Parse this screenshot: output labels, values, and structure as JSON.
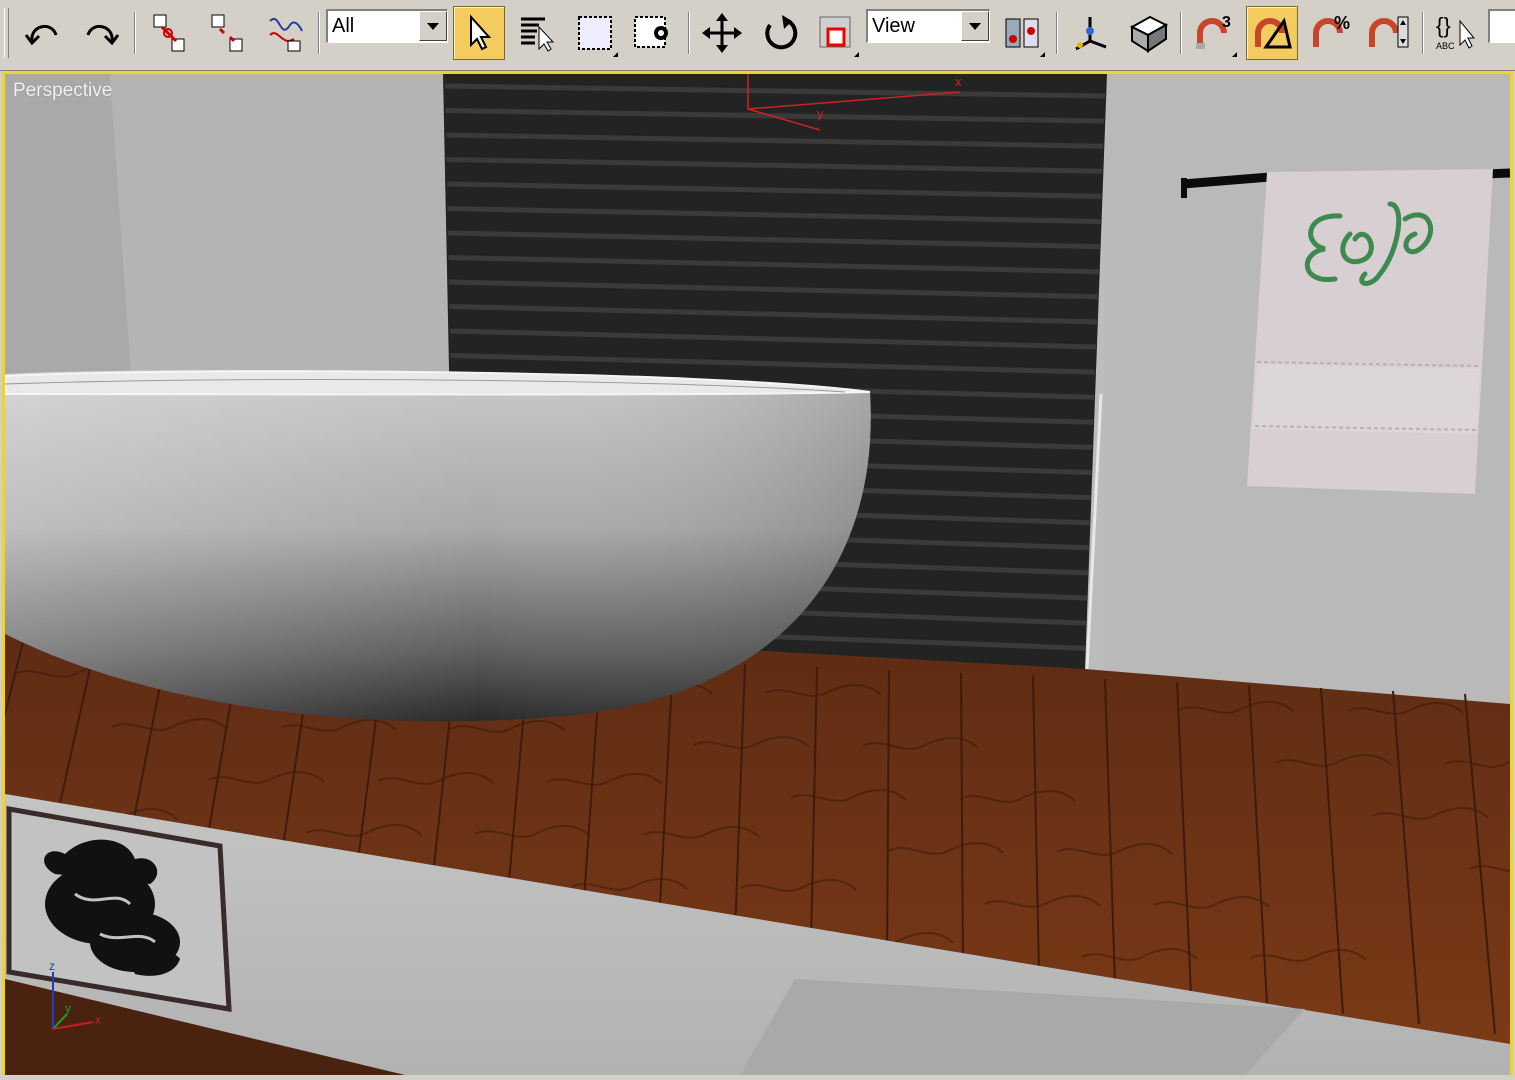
{
  "toolbar": {
    "buttons": [
      {
        "icon": "undo-icon",
        "state": "normal"
      },
      {
        "icon": "redo-icon",
        "state": "normal"
      },
      {
        "icon": "select-and-link-icon",
        "state": "normal"
      },
      {
        "icon": "unlink-selection-icon",
        "state": "normal"
      },
      {
        "icon": "bind-to-space-warp-icon",
        "state": "normal"
      },
      {
        "icon": "select-object-icon",
        "state": "active"
      },
      {
        "icon": "select-by-name-icon",
        "state": "normal"
      },
      {
        "icon": "rectangular-selection-region-icon",
        "state": "normal"
      },
      {
        "icon": "window-crossing-icon",
        "state": "normal"
      },
      {
        "icon": "select-and-move-icon",
        "state": "normal"
      },
      {
        "icon": "select-and-rotate-icon",
        "state": "normal"
      },
      {
        "icon": "select-and-scale-icon",
        "state": "normal"
      },
      {
        "icon": "use-pivot-center-icon",
        "state": "normal"
      },
      {
        "icon": "select-and-manipulate-icon",
        "state": "normal"
      },
      {
        "icon": "keyboard-shortcut-override-icon",
        "state": "normal"
      },
      {
        "icon": "snaps-toggle-icon",
        "state": "normal"
      },
      {
        "icon": "angle-snap-toggle-icon",
        "state": "active"
      },
      {
        "icon": "percent-snap-toggle-icon",
        "state": "normal"
      },
      {
        "icon": "spinner-snap-toggle-icon",
        "state": "normal"
      },
      {
        "icon": "edit-named-selection-sets-icon",
        "state": "normal"
      }
    ],
    "selection_filter": {
      "value": "All"
    },
    "reference_coordinate_system": {
      "value": "View"
    },
    "snap_dimension_label": "3",
    "percent_snap_label": "%",
    "named_selection_label": "{}",
    "named_selection_sublabel": "ABC"
  },
  "viewport": {
    "label": "Perspective",
    "active_border_color": "#f1d51f",
    "gizmo_axes": [
      "x",
      "y"
    ],
    "view_cube_axes": [
      "z",
      "y",
      "x"
    ]
  },
  "scene": {
    "wall_color": "#b8b8b8",
    "floor_color": "#5a2a14",
    "backsplash_color": "#1f1f1f",
    "towel_monogram_color": "#3e8a4e",
    "objects": [
      "bathtub",
      "striped-backsplash",
      "towel-bar",
      "monogram-towel",
      "wood-floor-deck",
      "dragon-picture-frame",
      "step-shadow"
    ]
  },
  "colors": {
    "toolbar_bg": "#d4d0c8",
    "active_button": "#f3cb5f"
  }
}
